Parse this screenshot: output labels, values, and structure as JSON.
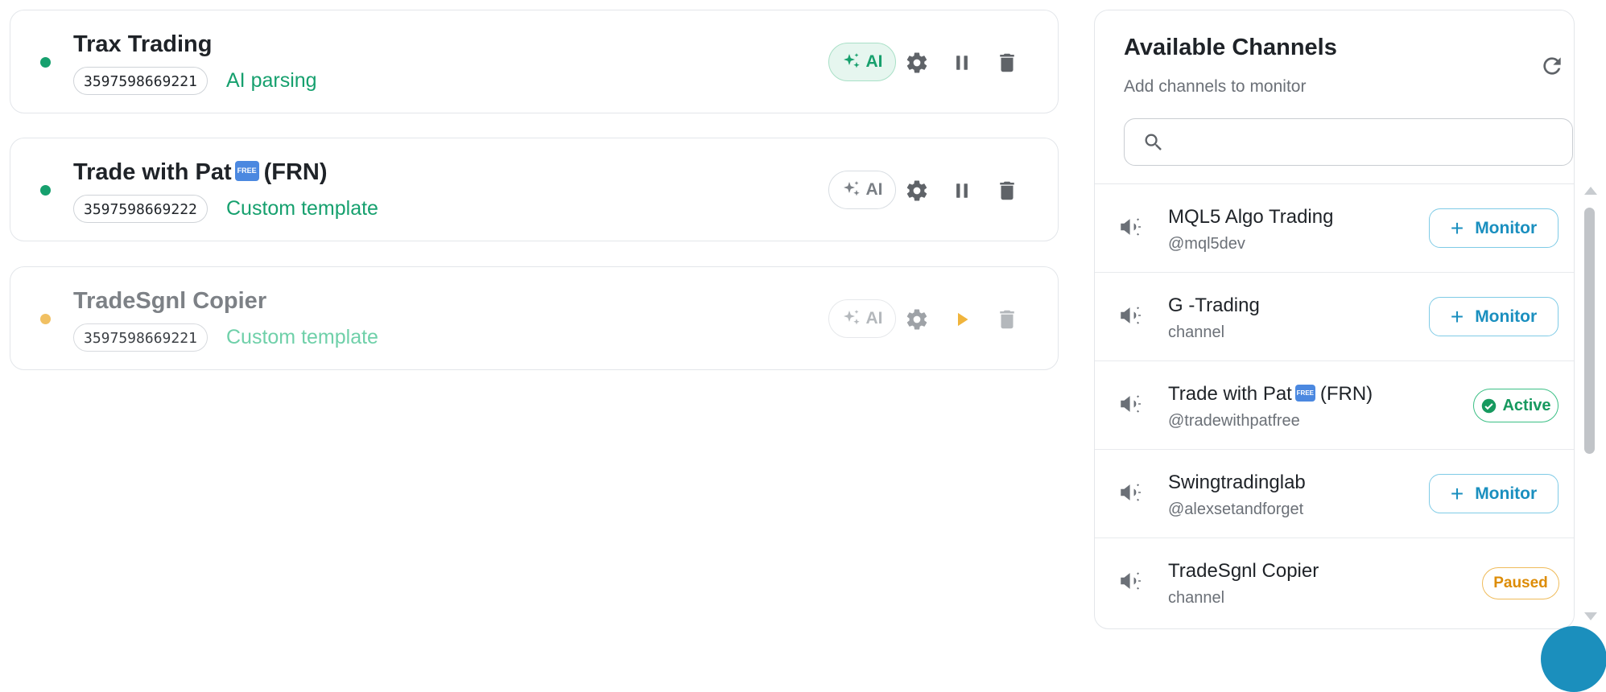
{
  "cards": [
    {
      "name": "Trax Trading",
      "free_badge": "",
      "suffix": "",
      "id": "3597598669221",
      "mode": "AI parsing",
      "ai_label": "AI",
      "status": "running",
      "status_color": "#16a06e"
    },
    {
      "name": "Trade with Pat",
      "free_badge": "FREE",
      "suffix": "(FRN)",
      "id": "3597598669222",
      "mode": "Custom template",
      "ai_label": "AI",
      "status": "running",
      "status_color": "#16a06e"
    },
    {
      "name": "TradeSgnl Copier",
      "free_badge": "",
      "suffix": "",
      "id": "3597598669221",
      "mode": "Custom template",
      "ai_label": "AI",
      "status": "paused",
      "status_color": "#f1c062"
    }
  ],
  "panel": {
    "title": "Available Channels",
    "subtitle": "Add channels to monitor",
    "search_value": "",
    "channels": [
      {
        "name": "MQL5 Algo Trading",
        "free_badge": "",
        "suffix": "",
        "handle": "@mql5dev",
        "action": "Monitor"
      },
      {
        "name": "G -Trading",
        "free_badge": "",
        "suffix": "",
        "handle": "channel",
        "action": "Monitor"
      },
      {
        "name": "Trade with Pat",
        "free_badge": "FREE",
        "suffix": "(FRN)",
        "handle": "@tradewithpatfree",
        "action": "Active"
      },
      {
        "name": "Swingtradinglab",
        "free_badge": "",
        "suffix": "",
        "handle": "@alexsetandforget",
        "action": "Monitor"
      },
      {
        "name": "TradeSgnl Copier",
        "free_badge": "",
        "suffix": "",
        "handle": "channel",
        "action": "Paused"
      }
    ]
  },
  "colors": {
    "accent_green": "#16a06e",
    "monitor_blue": "#1a8fbf",
    "paused_amber": "#dd8c06"
  }
}
